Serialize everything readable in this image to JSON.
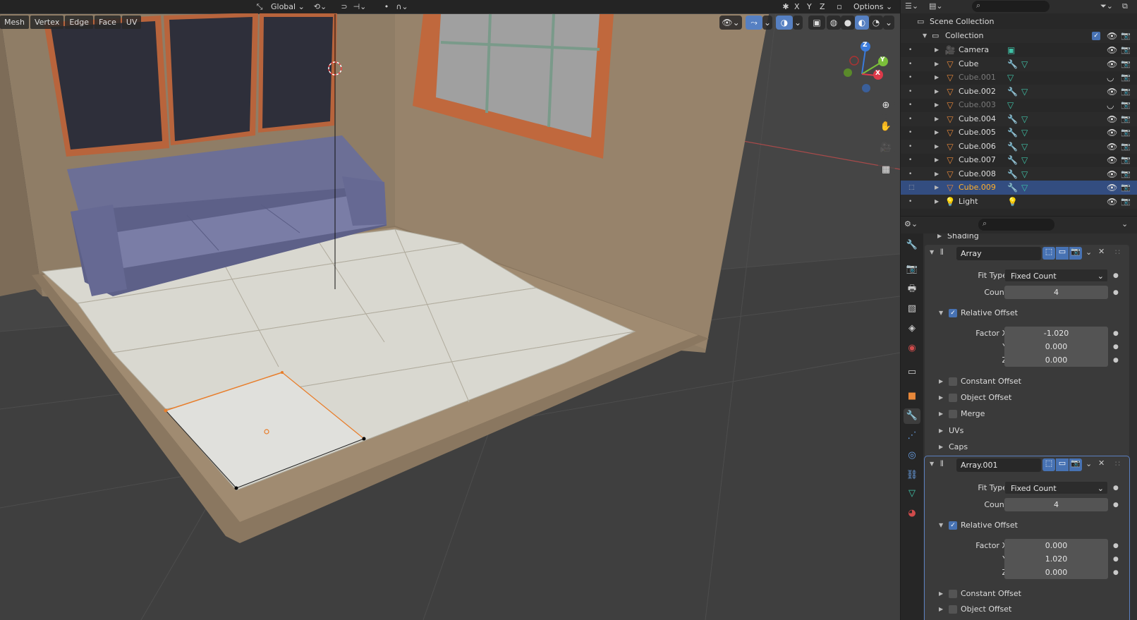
{
  "toolbar": {
    "transform_orientation": "Global",
    "axis_x": "X",
    "axis_y": "Y",
    "axis_z": "Z",
    "options": "Options"
  },
  "edit_menu": {
    "mesh": "Mesh",
    "vertex": "Vertex",
    "edge": "Edge",
    "face": "Face",
    "uv": "UV"
  },
  "gizmo": {
    "x": "X",
    "y": "Y",
    "z": "Z"
  },
  "outliner": {
    "scene_collection": "Scene Collection",
    "collection": "Collection",
    "items": [
      {
        "name": "Camera",
        "type": "camera",
        "visible": true
      },
      {
        "name": "Cube",
        "type": "mesh",
        "visible": true
      },
      {
        "name": "Cube.001",
        "type": "mesh",
        "visible": false
      },
      {
        "name": "Cube.002",
        "type": "mesh",
        "visible": true
      },
      {
        "name": "Cube.003",
        "type": "mesh",
        "visible": false
      },
      {
        "name": "Cube.004",
        "type": "mesh",
        "visible": true
      },
      {
        "name": "Cube.005",
        "type": "mesh",
        "visible": true
      },
      {
        "name": "Cube.006",
        "type": "mesh",
        "visible": true
      },
      {
        "name": "Cube.007",
        "type": "mesh",
        "visible": true
      },
      {
        "name": "Cube.008",
        "type": "mesh",
        "visible": true
      },
      {
        "name": "Cube.009",
        "type": "mesh",
        "visible": true,
        "selected": true
      },
      {
        "name": "Light",
        "type": "light",
        "visible": true
      }
    ]
  },
  "properties": {
    "shading_label": "Shading",
    "array1": {
      "name": "Array",
      "fit_type_label": "Fit Type",
      "fit_type": "Fixed Count",
      "count_label": "Count",
      "count": "4",
      "relative_offset": "Relative Offset",
      "factor_x_label": "Factor X",
      "factor_x": "-1.020",
      "y_label": "Y",
      "factor_y": "0.000",
      "z_label": "Z",
      "factor_z": "0.000",
      "constant_offset": "Constant Offset",
      "object_offset": "Object Offset",
      "merge": "Merge",
      "uvs": "UVs",
      "caps": "Caps"
    },
    "array2": {
      "name": "Array.001",
      "fit_type_label": "Fit Type",
      "fit_type": "Fixed Count",
      "count_label": "Count",
      "count": "4",
      "relative_offset": "Relative Offset",
      "factor_x_label": "Factor X",
      "factor_x": "0.000",
      "y_label": "Y",
      "factor_y": "1.020",
      "z_label": "Z",
      "factor_z": "0.000",
      "constant_offset": "Constant Offset",
      "object_offset": "Object Offset"
    }
  },
  "colors": {
    "accent_blue": "#4772b3",
    "selected_row": "#334d80",
    "active_object": "#ffaf29",
    "wall": "#8f7d66",
    "window_frame": "#b8643c",
    "sofa": "#6c6f96",
    "floor_tile": "#d9d8d0"
  }
}
